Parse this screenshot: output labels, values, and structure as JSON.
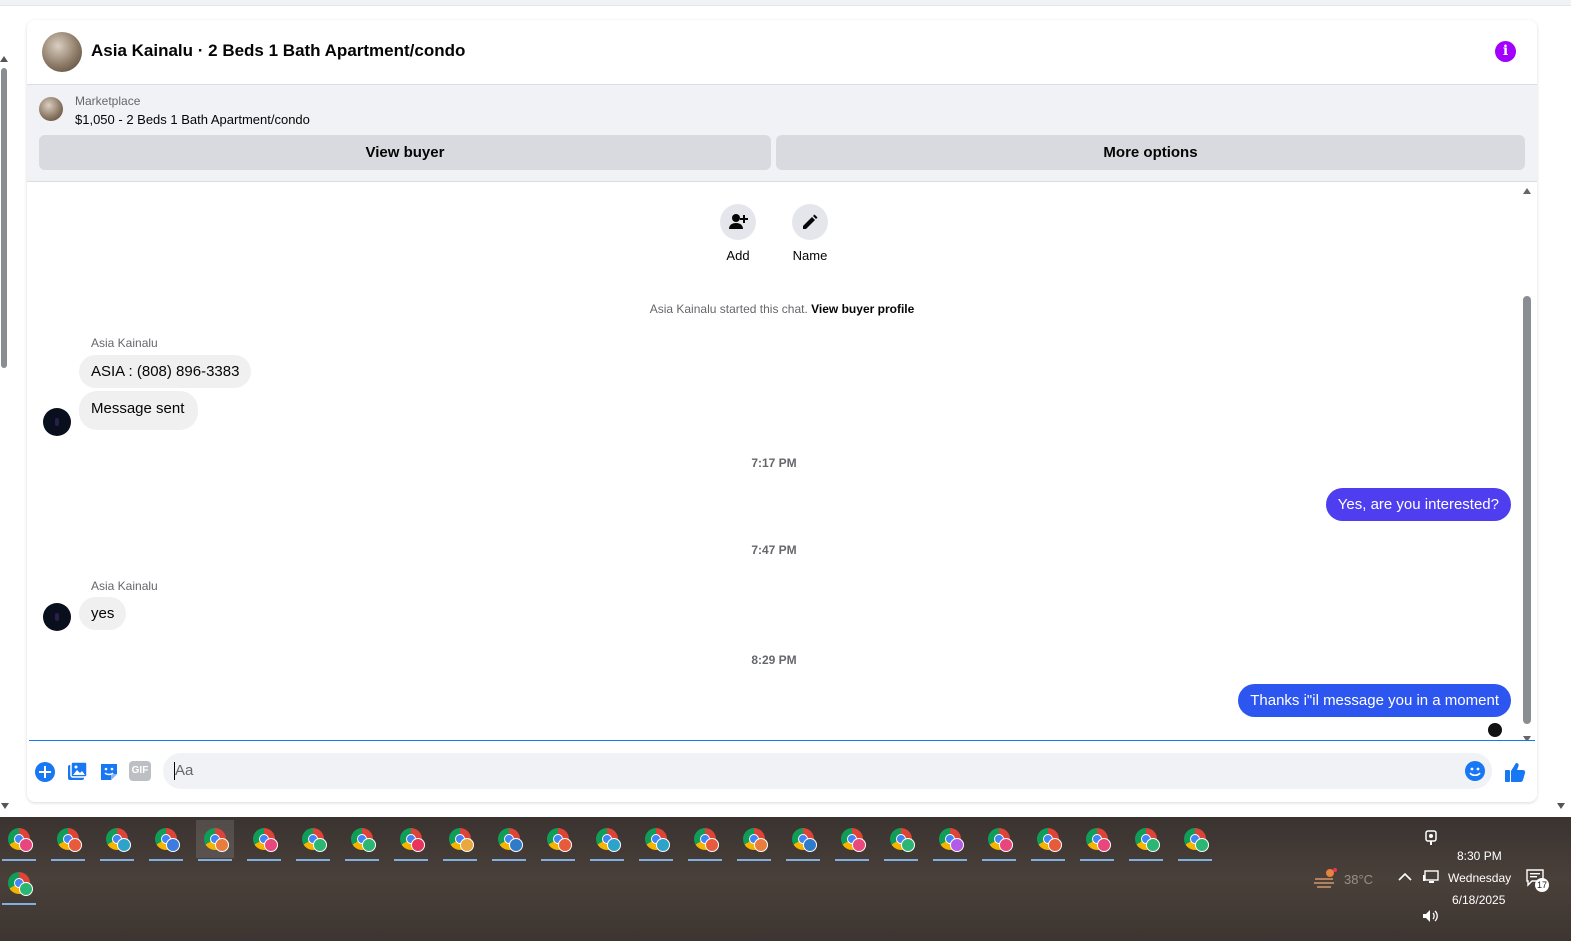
{
  "header": {
    "title": "Asia Kainalu · 2 Beds 1 Bath Apartment/condo",
    "info_icon": "info-icon"
  },
  "listing": {
    "kind": "Marketplace",
    "description": "$1,050 - 2 Beds 1 Bath Apartment/condo",
    "view_buyer_label": "View buyer",
    "more_options_label": "More options"
  },
  "actions": {
    "add_label": "Add",
    "name_label": "Name"
  },
  "chat": {
    "started_text": "Asia Kainalu started this chat.",
    "profile_link": "View buyer profile",
    "messages": [
      {
        "sender": "Asia Kainalu",
        "text": "ASIA : (808) 896-3383"
      },
      {
        "text": "Message sent"
      },
      {
        "time": "7:17 PM"
      },
      {
        "out": true,
        "text": "Yes, are you interested?"
      },
      {
        "time": "7:47 PM"
      },
      {
        "sender": "Asia Kainalu",
        "text": "yes"
      },
      {
        "time": "8:29 PM"
      },
      {
        "out": true,
        "text": "Thanks i\"il message you in a moment"
      }
    ]
  },
  "composer": {
    "placeholder": "Aa",
    "gif_label": "GIF"
  },
  "colors": {
    "accent": "#1877f2",
    "outgoing_bubble": "#2d55f0",
    "info": "#a100ff"
  },
  "taskbar": {
    "weather": "38°C",
    "time": "8:30 PM",
    "day": "Wednesday",
    "date": "6/18/2025",
    "notifications": "17",
    "badge_colors": [
      "#e8467c",
      "#e85a3c",
      "#2ea3c9",
      "#3e7be0",
      "#e87c3c",
      "#e8467c",
      "#2bb673",
      "#2bb673",
      "#e8335c",
      "#e8a83c",
      "#2e7cc9",
      "#e85a3c",
      "#2ea3c9",
      "#2ea3c9",
      "#e85a3c",
      "#e87c3c",
      "#2e7cc9",
      "#e84a7c",
      "#2bb673",
      "#b45ae8",
      "#e8467c",
      "#e85a3c",
      "#e8467c",
      "#2bb673",
      "#2bb673",
      "#2bb673"
    ]
  }
}
